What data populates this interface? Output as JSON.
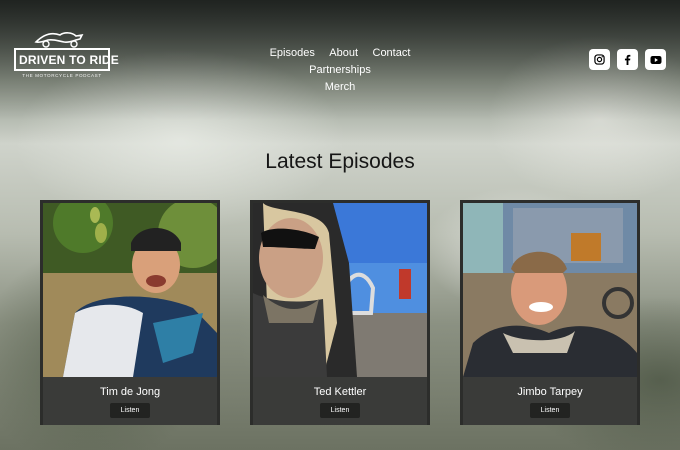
{
  "site": {
    "logo_title": "DRIVEN TO RIDE",
    "logo_tagline": "THE MOTORCYCLE PODCAST",
    "logo_icon": "motorcycle-icon"
  },
  "nav": {
    "items": [
      {
        "label": "Episodes"
      },
      {
        "label": "About"
      },
      {
        "label": "Contact"
      },
      {
        "label": "Partnerships"
      },
      {
        "label": "Merch"
      }
    ]
  },
  "socials": [
    {
      "icon": "instagram-icon"
    },
    {
      "icon": "facebook-icon"
    },
    {
      "icon": "youtube-icon"
    }
  ],
  "section": {
    "title": "Latest Episodes"
  },
  "episodes": [
    {
      "name": "Tim de Jong",
      "button": "Listen"
    },
    {
      "name": "Ted Kettler",
      "button": "Listen"
    },
    {
      "name": "Jimbo Tarpey",
      "button": "Listen"
    }
  ],
  "colors": {
    "card_background": "#2c2d2b",
    "card_footer": "#3a3b39",
    "button": "#222321",
    "title_text": "#161616"
  }
}
